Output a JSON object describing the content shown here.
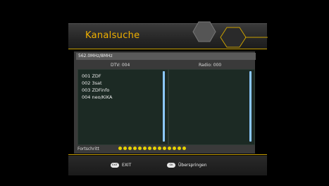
{
  "header": {
    "title": "Kanalsuche"
  },
  "scan": {
    "frequency": "562.0MHz/8MHz",
    "dtv_label": "DTV: 004",
    "radio_label": "Radio: 000",
    "tv_channels": [
      {
        "label": "001 ZDF"
      },
      {
        "label": "002 3sat"
      },
      {
        "label": "003 ZDFinfo"
      },
      {
        "label": "004 neo/KiKA"
      }
    ],
    "radio_channels": []
  },
  "progress": {
    "label": "Fortschritt",
    "dots": 14
  },
  "footer": {
    "exit_label": "EXIT",
    "exit_key": "EXIT",
    "skip_label": "Überspringen",
    "skip_key": "OK"
  },
  "colors": {
    "accent": "#c9a000",
    "title": "#f0b000",
    "progress_dot": "#e5d200",
    "scrollbar": "#8cc8ff"
  }
}
